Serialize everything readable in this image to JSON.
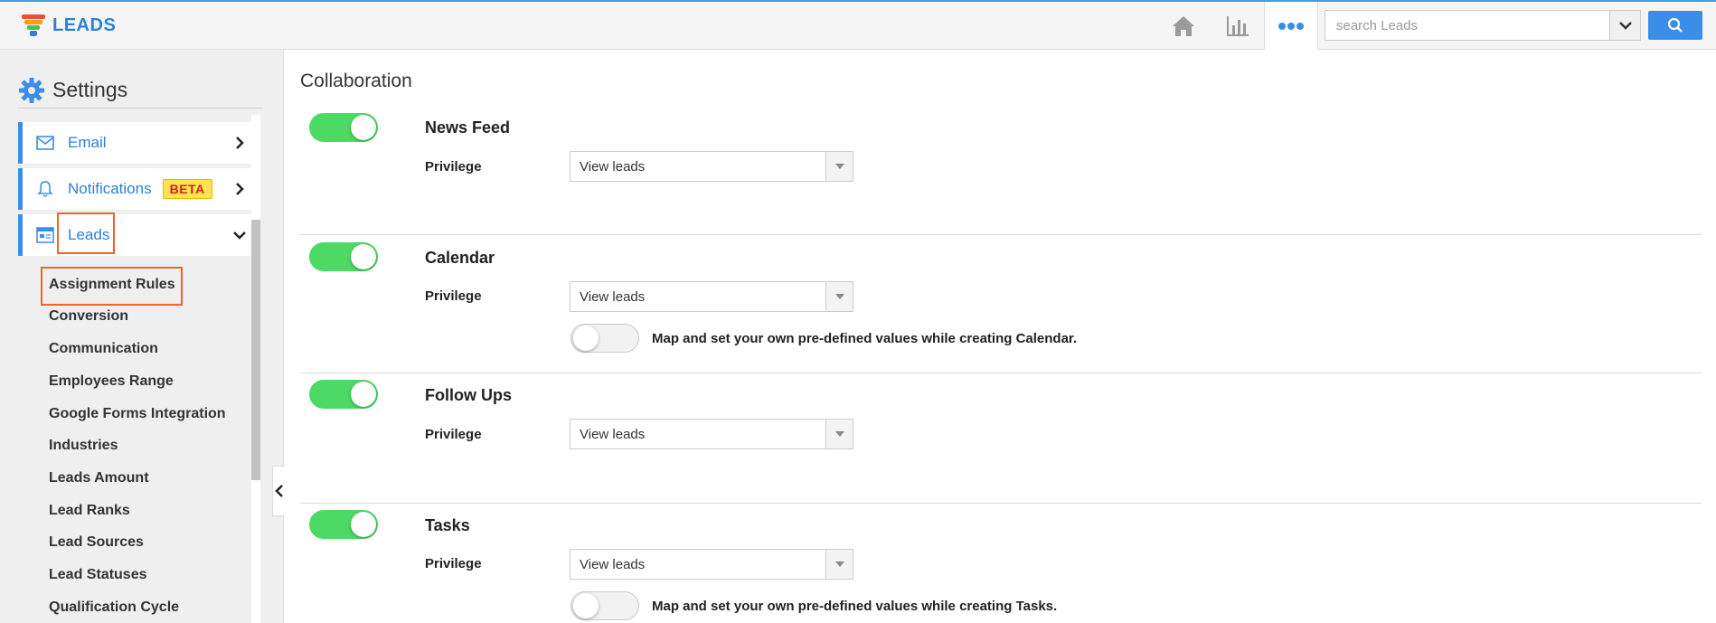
{
  "app": {
    "name": "LEADS"
  },
  "search": {
    "placeholder": "search Leads"
  },
  "sidebar": {
    "title": "Settings",
    "menu": [
      {
        "label": "Email"
      },
      {
        "label": "Notifications",
        "badge": "BETA"
      },
      {
        "label": "Leads"
      }
    ],
    "submenu": [
      "Assignment Rules",
      "Conversion",
      "Communication",
      "Employees Range",
      "Google Forms Integration",
      "Industries",
      "Leads Amount",
      "Lead Ranks",
      "Lead Sources",
      "Lead Statuses",
      "Qualification Cycle"
    ]
  },
  "main": {
    "title": "Collaboration",
    "sections": [
      {
        "title": "News Feed",
        "enabled": true,
        "privilege_label": "Privilege",
        "privilege_value": "View leads"
      },
      {
        "title": "Calendar",
        "enabled": true,
        "privilege_label": "Privilege",
        "privilege_value": "View leads",
        "map_enabled": false,
        "map_text": "Map and set your own pre-defined values while creating Calendar."
      },
      {
        "title": "Follow Ups",
        "enabled": true,
        "privilege_label": "Privilege",
        "privilege_value": "View leads"
      },
      {
        "title": "Tasks",
        "enabled": true,
        "privilege_label": "Privilege",
        "privilege_value": "View leads",
        "map_enabled": false,
        "map_text": "Map and set your own pre-defined values while creating Tasks."
      }
    ]
  },
  "colors": {
    "accent": "#3a8de8",
    "toggle_on": "#4cd964",
    "highlight": "#f0642a"
  },
  "icons": {
    "home": "home-icon",
    "chart": "bar-chart-icon",
    "more": "more-dots-icon",
    "search": "search-icon",
    "settings": "gear-icon"
  }
}
